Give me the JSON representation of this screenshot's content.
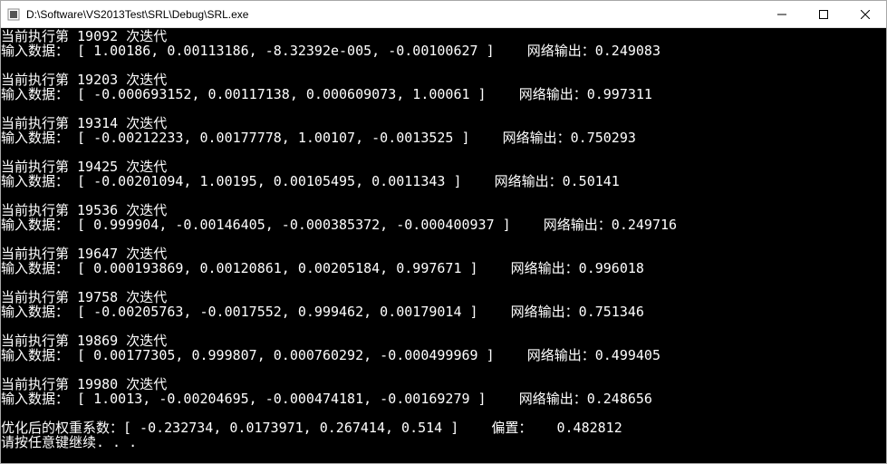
{
  "window": {
    "title": "D:\\Software\\VS2013Test\\SRL\\Debug\\SRL.exe"
  },
  "labels": {
    "current_iter_prefix": "当前执行第 ",
    "current_iter_suffix": " 次迭代",
    "input_prefix": "输入数据：",
    "output_prefix": "网络输出：",
    "weights_prefix": "优化后的权重系数：",
    "bias_prefix": "偏置：",
    "continue_prompt": "请按任意键继续. . ."
  },
  "iterations": [
    {
      "iter": "19092",
      "inputs": "[ 1.00186, 0.00113186, -8.32392e-005, -0.00100627 ]",
      "output": "0.249083"
    },
    {
      "iter": "19203",
      "inputs": "[ -0.000693152, 0.00117138, 0.000609073, 1.00061 ]",
      "output": "0.997311"
    },
    {
      "iter": "19314",
      "inputs": "[ -0.00212233, 0.00177778, 1.00107, -0.0013525 ]",
      "output": "0.750293"
    },
    {
      "iter": "19425",
      "inputs": "[ -0.00201094, 1.00195, 0.00105495, 0.0011343 ]",
      "output": "0.50141"
    },
    {
      "iter": "19536",
      "inputs": "[ 0.999904, -0.00146405, -0.000385372, -0.000400937 ]",
      "output": "0.249716"
    },
    {
      "iter": "19647",
      "inputs": "[ 0.000193869, 0.00120861, 0.00205184, 0.997671 ]",
      "output": "0.996018"
    },
    {
      "iter": "19758",
      "inputs": "[ -0.00205763, -0.0017552, 0.999462, 0.00179014 ]",
      "output": "0.751346"
    },
    {
      "iter": "19869",
      "inputs": "[ 0.00177305, 0.999807, 0.000760292, -0.000499969 ]",
      "output": "0.499405"
    },
    {
      "iter": "19980",
      "inputs": "[ 1.0013, -0.00204695, -0.000474181, -0.00169279 ]",
      "output": "0.248656"
    }
  ],
  "result": {
    "weights": "[ -0.232734, 0.0173971, 0.267414, 0.514 ]",
    "bias": "0.482812"
  }
}
